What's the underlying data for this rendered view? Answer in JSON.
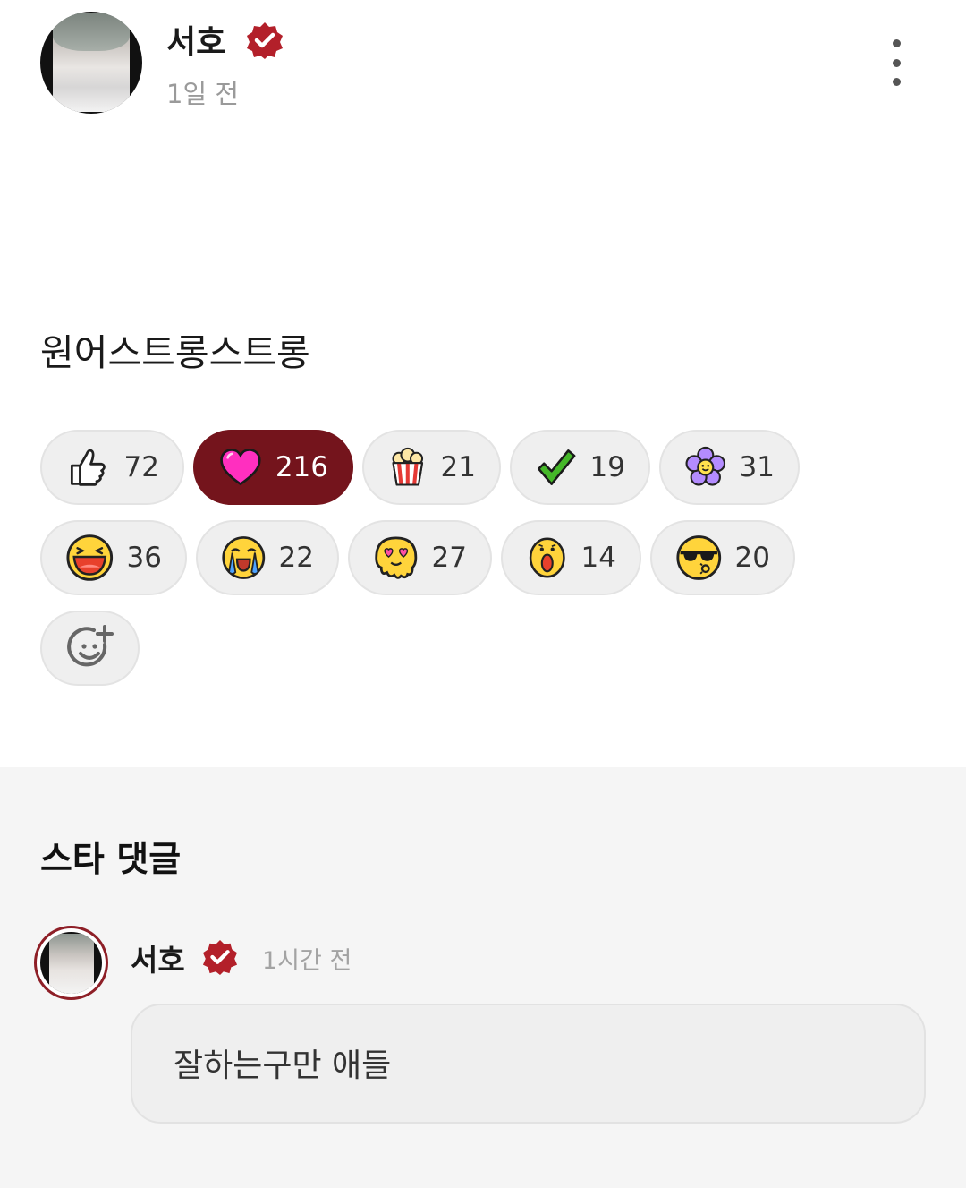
{
  "post": {
    "author_name": "서호",
    "time": "1일 전",
    "text": "원어스트롱스트롱"
  },
  "reactions": [
    {
      "icon": "thumbs-up-icon",
      "count": "72",
      "active": false
    },
    {
      "icon": "heart-icon",
      "count": "216",
      "active": true
    },
    {
      "icon": "popcorn-icon",
      "count": "21",
      "active": false
    },
    {
      "icon": "checkmark-icon",
      "count": "19",
      "active": false
    },
    {
      "icon": "flower-icon",
      "count": "31",
      "active": false
    },
    {
      "icon": "laughing-face-icon",
      "count": "36",
      "active": false
    },
    {
      "icon": "crying-face-icon",
      "count": "22",
      "active": false
    },
    {
      "icon": "heart-eyes-melting-face-icon",
      "count": "27",
      "active": false
    },
    {
      "icon": "surprised-face-icon",
      "count": "14",
      "active": false
    },
    {
      "icon": "sunglasses-face-icon",
      "count": "20",
      "active": false
    }
  ],
  "add_reaction_icon": "add-emoji-icon",
  "star_comments": {
    "title": "스타 댓글",
    "comment": {
      "author_name": "서호",
      "time": "1시간 전",
      "text": "잘하는구만 애들"
    }
  },
  "colors": {
    "accent": "#74141c",
    "verified_badge": "#b3202a",
    "comment_section_bg": "#f5f5f5"
  }
}
